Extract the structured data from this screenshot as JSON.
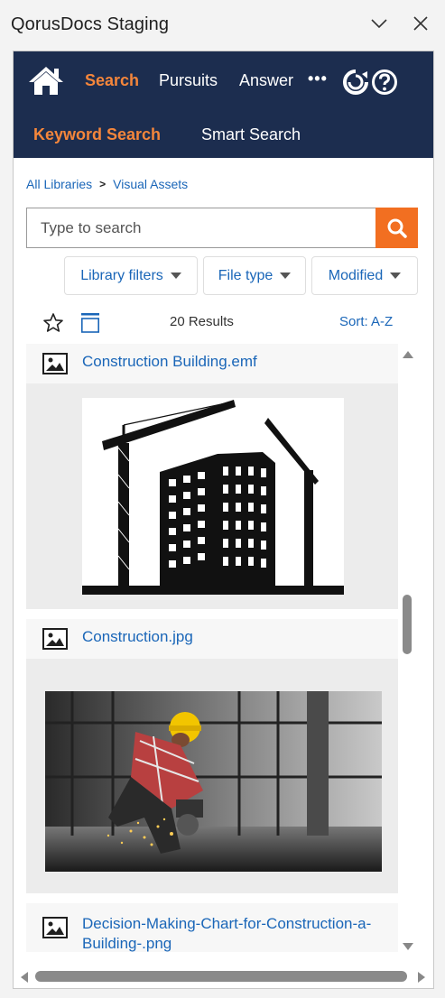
{
  "window": {
    "title": "QorusDocs Staging",
    "minimize_icon": "chevron-down-icon",
    "close_icon": "close-icon"
  },
  "nav": {
    "home_icon": "home-icon",
    "items": [
      {
        "label": "Search",
        "active": true
      },
      {
        "label": "Pursuits",
        "active": false
      },
      {
        "label": "Answer",
        "active": false
      }
    ],
    "more_label": "•••",
    "refresh_icon": "refresh-icon",
    "help_icon": "help-icon",
    "sub_items": [
      {
        "label": "Keyword Search",
        "active": true
      },
      {
        "label": "Smart Search",
        "active": false
      }
    ]
  },
  "breadcrumb": {
    "items": [
      "All Libraries",
      "Visual Assets"
    ],
    "separator": ">"
  },
  "search": {
    "placeholder": "Type to search",
    "value": "",
    "button_icon": "search-icon"
  },
  "filters": [
    {
      "label": "Library filters"
    },
    {
      "label": "File type"
    },
    {
      "label": "Modified"
    }
  ],
  "results": {
    "count_label": "20 Results",
    "sort_label": "Sort:  A-Z",
    "items": [
      {
        "name": "Construction Building.emf",
        "icon": "image-icon"
      },
      {
        "name": "Construction.jpg",
        "icon": "image-icon"
      },
      {
        "name": "Decision-Making-Chart-for-Construction-a-Building-.png",
        "icon": "image-icon"
      }
    ]
  },
  "colors": {
    "nav_bg": "#1c2d4f",
    "accent": "#f26f21",
    "link": "#1a66b8"
  }
}
